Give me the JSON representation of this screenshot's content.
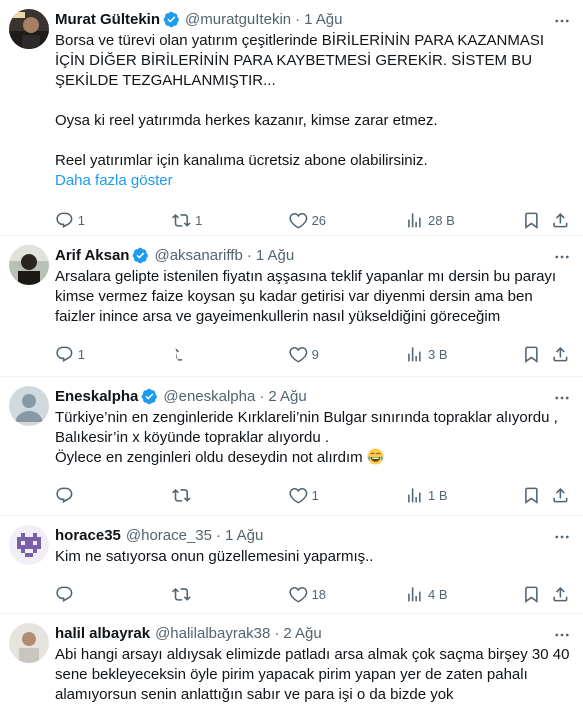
{
  "tweets": [
    {
      "name": "Murat Gültekin",
      "verified": true,
      "handle": "@muratguItekin",
      "time": "1 Ağu",
      "text": "Borsa ve türevi olan yatırım çeşitlerinde BİRİLERİNİN PARA KAZANMASI İÇİN DİĞER BİRİLERİNİN PARA KAYBETMESİ GEREKİR. SİSTEM BU ŞEKİLDE TEZGAHLANMIŞTIR...\n\nOysa ki reel yatırımda herkes kazanır, kimse zarar etmez.\n\nReel yatırımlar için kanalıma ücretsiz abone olabilirsiniz.",
      "show_more": "Daha fazla göster",
      "replies": "1",
      "retweets": "1",
      "likes": "26",
      "views": "28 B"
    },
    {
      "name": "Arif Aksan",
      "verified": true,
      "handle": "@aksanariffb",
      "time": "1 Ağu",
      "text": "Arsalara gelipte istenilen fiyatın aşşasına teklif yapanlar mı dersin bu parayı kimse vermez faize koysan şu kadar getirisi var diyenmi dersin ama ben faizler inince arsa ve gayeimenkullerin nasıl yükseldiğini göreceğim",
      "replies": "1",
      "retweets": "",
      "likes": "9",
      "views": "3 B"
    },
    {
      "name": "Eneskalpha",
      "verified": true,
      "handle": "@eneskalpha",
      "time": "2 Ağu",
      "text": "Türkiye’nin en zenginleride Kırklareli’nin Bulgar sınırında topraklar alıyordu ,\nBalıkesir’in x köyünde topraklar alıyordu .\nÖylece en zenginleri oldu deseydin not alırdım",
      "emoji": "laughing-tears-emoji",
      "replies": "",
      "retweets": "",
      "likes": "1",
      "views": "1 B"
    },
    {
      "name": "horace35",
      "verified": false,
      "handle": "@horace_35",
      "time": "1 Ağu",
      "text": "Kim ne satıyorsa onun güzellemesini yaparmış..",
      "replies": "",
      "retweets": "",
      "likes": "18",
      "views": "4 B"
    },
    {
      "name": "halil albayrak",
      "verified": false,
      "handle": "@halilalbayrak38",
      "time": "2 Ağu",
      "text": "Abi hangi arsayı aldıysak elimizde patladı  arsa almak çok saçma birşey 30 40 sene bekleyeceksin öyle pirim yapacak pirim yapan yer de zaten pahalı alamıyorsun senin anlattığın sabır ve para  işi o da bizde yok",
      "replies": "",
      "retweets": "",
      "likes": "",
      "views": ""
    }
  ],
  "colors": {
    "text": "#0f1419",
    "secondary": "#536471",
    "link": "#1d9bf0",
    "verified": "#1d9bf0",
    "divider": "#eff3f4"
  },
  "icons": {
    "reply": "reply-icon",
    "retweet": "retweet-icon",
    "like": "heart-icon",
    "views": "views-icon",
    "bookmark": "bookmark-icon",
    "share": "share-icon",
    "more": "more-icon",
    "verified": "verified-badge-icon"
  }
}
